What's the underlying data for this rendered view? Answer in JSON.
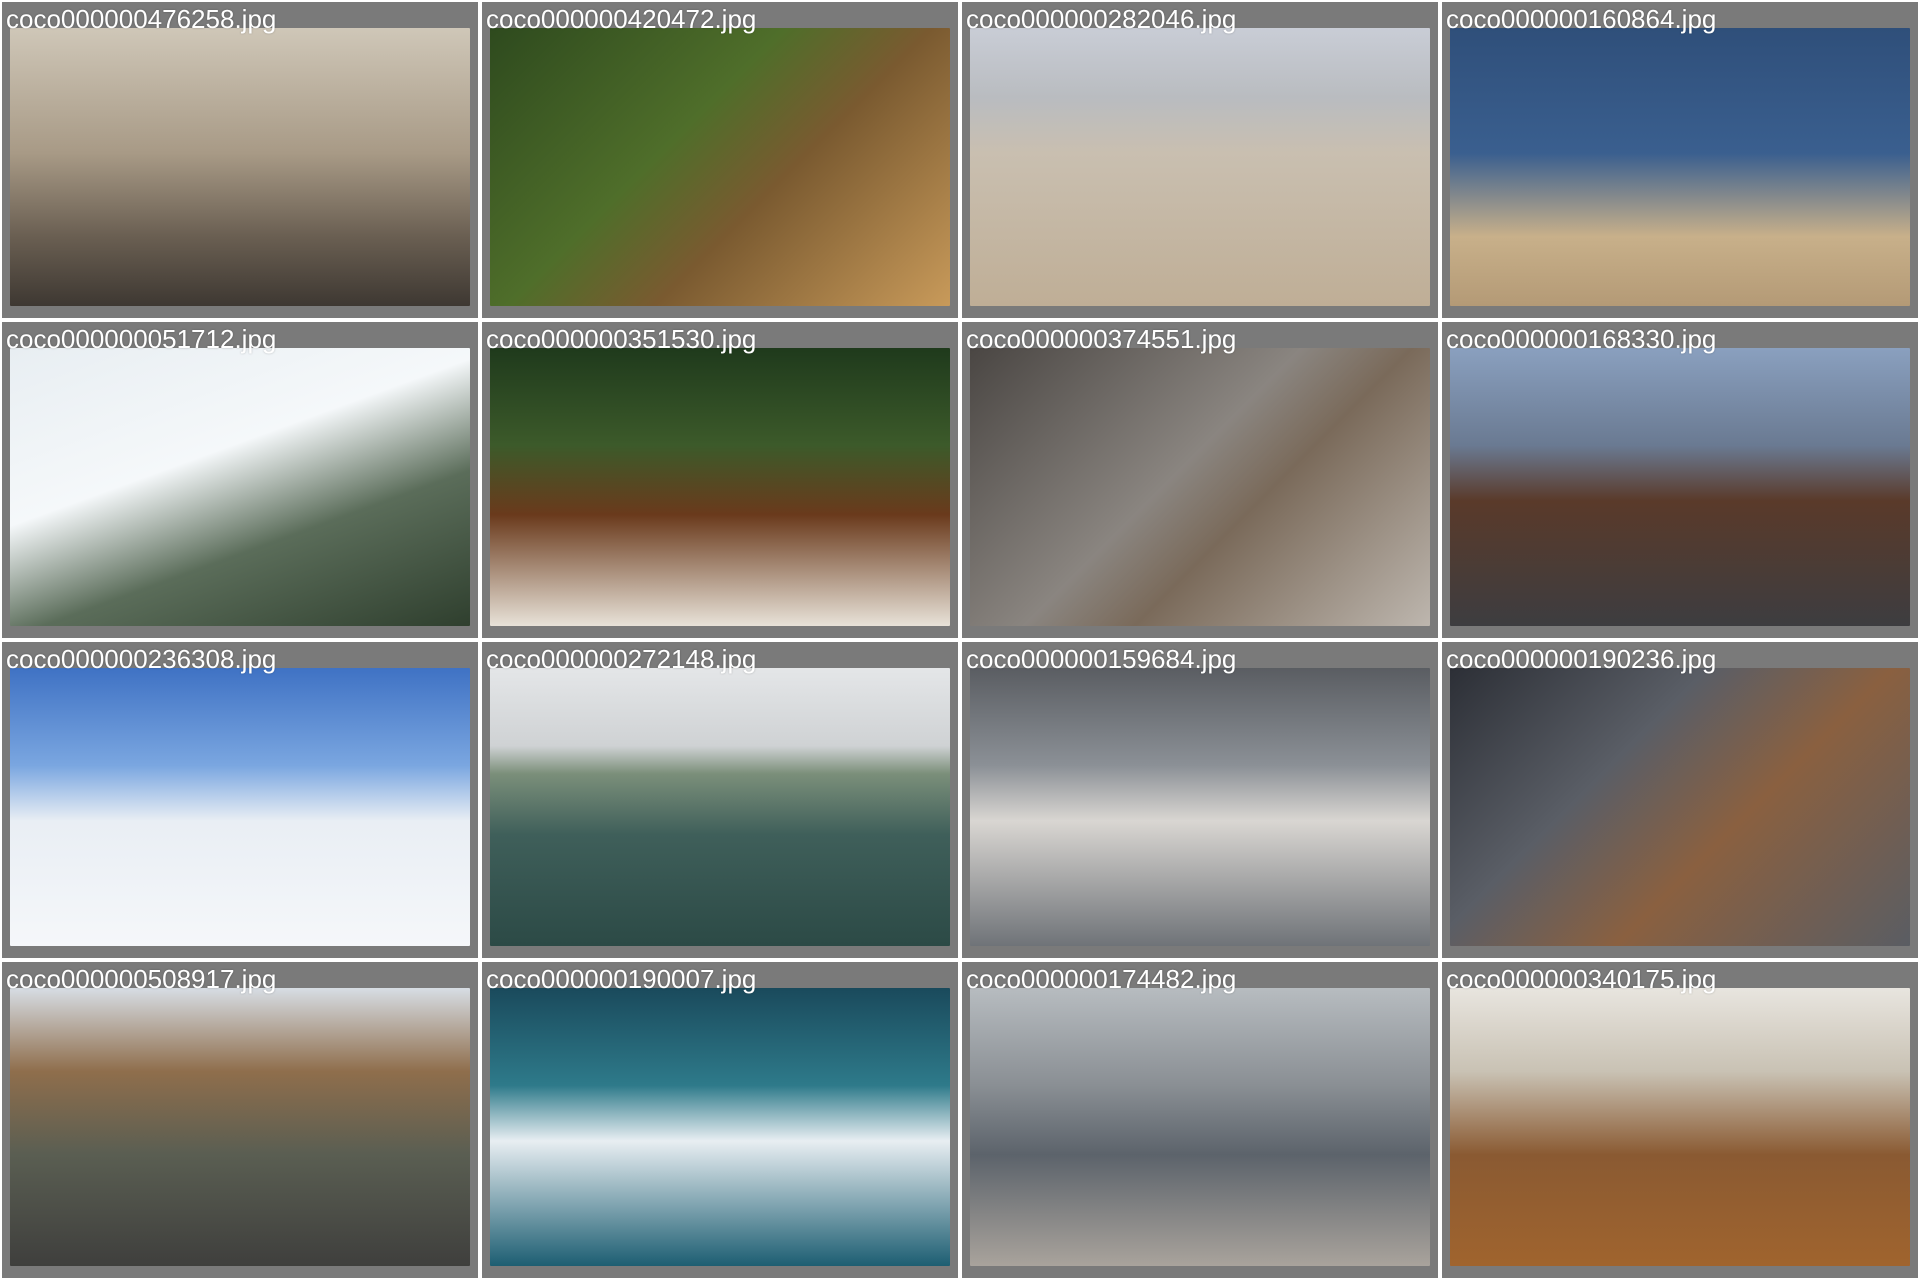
{
  "gallery": {
    "tiles": [
      {
        "filename": "coco000000476258.jpg"
      },
      {
        "filename": "coco000000420472.jpg"
      },
      {
        "filename": "coco000000282046.jpg"
      },
      {
        "filename": "coco000000160864.jpg"
      },
      {
        "filename": "coco000000051712.jpg"
      },
      {
        "filename": "coco000000351530.jpg"
      },
      {
        "filename": "coco000000374551.jpg"
      },
      {
        "filename": "coco000000168330.jpg"
      },
      {
        "filename": "coco000000236308.jpg"
      },
      {
        "filename": "coco000000272148.jpg"
      },
      {
        "filename": "coco000000159684.jpg"
      },
      {
        "filename": "coco000000190236.jpg"
      },
      {
        "filename": "coco000000508917.jpg"
      },
      {
        "filename": "coco000000190007.jpg"
      },
      {
        "filename": "coco000000174482.jpg"
      },
      {
        "filename": "coco000000340175.jpg"
      }
    ]
  },
  "colors": {
    "tile_background": "#7a7a7a",
    "label_text": "#ffffff"
  }
}
